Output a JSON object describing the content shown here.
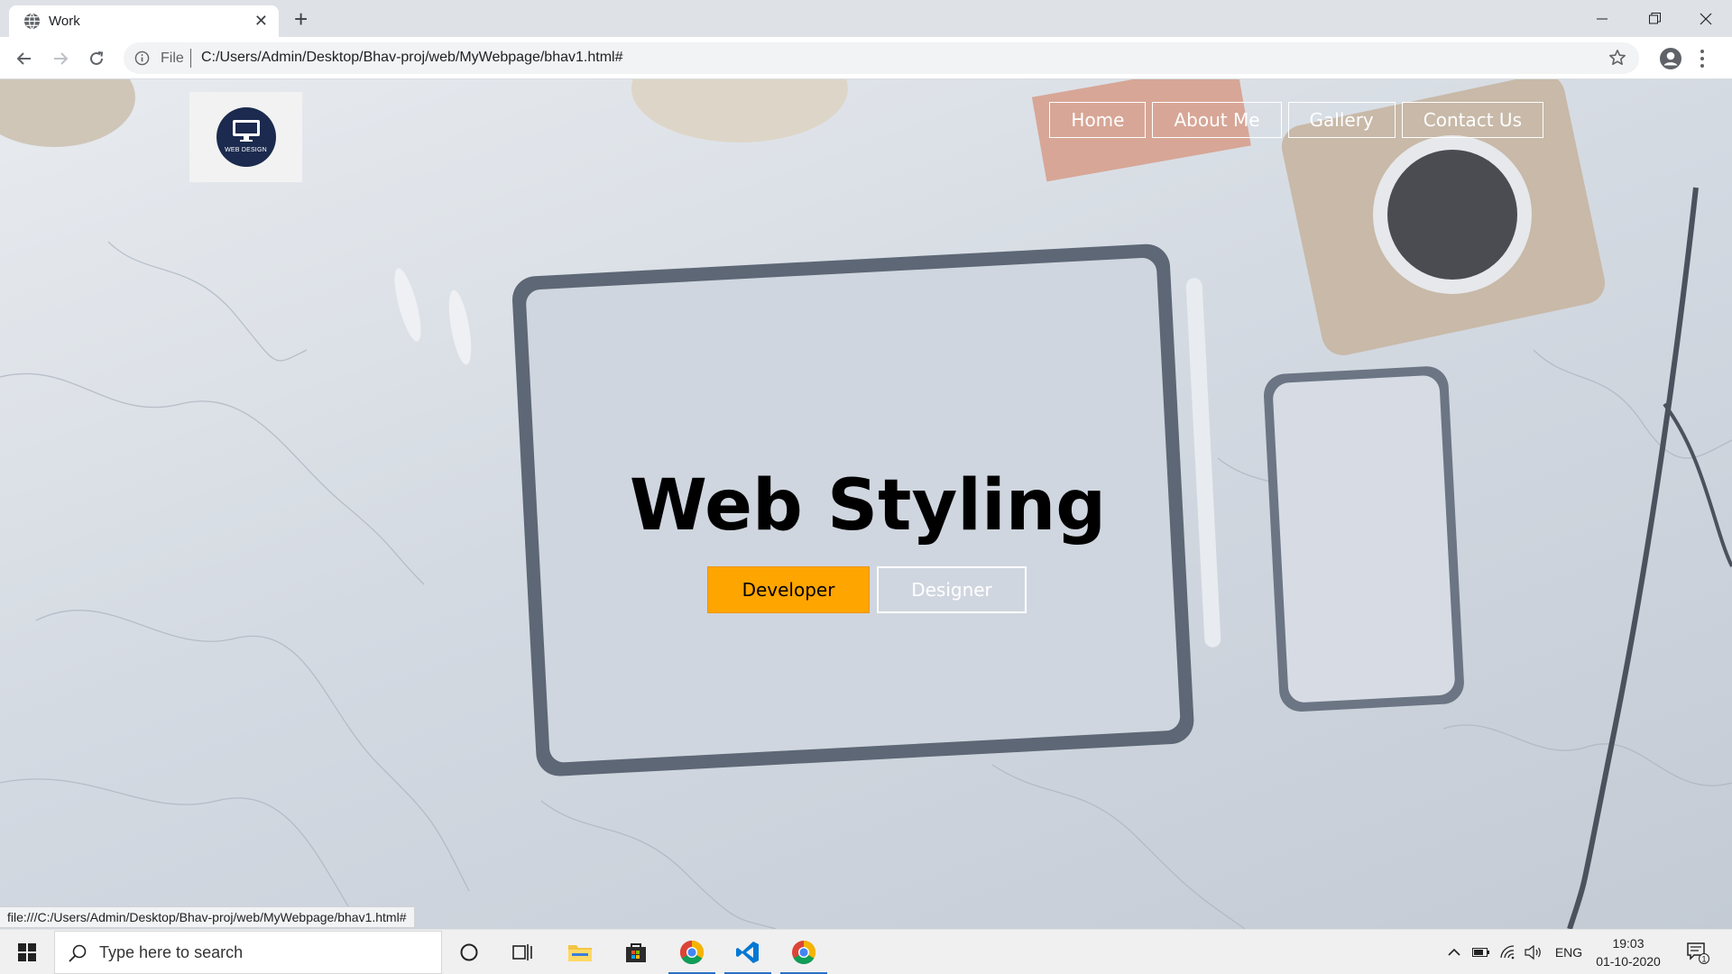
{
  "browser": {
    "tab_title": "Work",
    "close_tab_glyph": "✕",
    "new_tab_glyph": "+",
    "file_label": "File",
    "url": "C:/Users/Admin/Desktop/Bhav-proj/web/MyWebpage/bhav1.html#",
    "status_url": "file:///C:/Users/Admin/Desktop/Bhav-proj/web/MyWebpage/bhav1.html#"
  },
  "page": {
    "logo_text": "WEB DESIGN",
    "nav": [
      "Home",
      "About Me",
      "Gallery",
      "Contact Us"
    ],
    "hero_title": "Web Styling",
    "buttons": {
      "developer": "Developer",
      "designer": "Designer"
    },
    "colors": {
      "accent": "#ffa500",
      "logo_bg": "#1b2a4e"
    }
  },
  "taskbar": {
    "search_placeholder": "Type here to search",
    "language": "ENG",
    "time": "19:03",
    "date": "01-10-2020",
    "notification_count": "1"
  }
}
